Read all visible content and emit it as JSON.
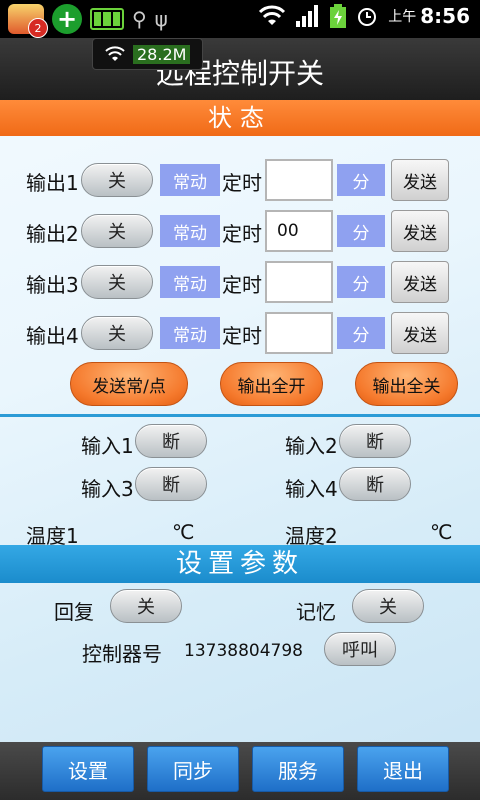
{
  "status_bar": {
    "notification_badge": "2",
    "plus_symbol": "+",
    "am_pm": "上午",
    "time": "8:56",
    "icons": [
      "app-notification-icon",
      "plus-app-icon",
      "battery-widget-icon",
      "android-debug-icon",
      "usb-icon",
      "wifi-icon",
      "signal-icon",
      "battery-charging-icon",
      "alarm-icon"
    ]
  },
  "net_overlay": {
    "speed": "28.2M"
  },
  "title": "远程控制开关",
  "status_section": {
    "header": "状态"
  },
  "outputs": [
    {
      "label": "输出1",
      "toggle": "关",
      "mode": "常动",
      "timer_label": "定时",
      "timer_value": "",
      "unit": "分",
      "send": "发送"
    },
    {
      "label": "输出2",
      "toggle": "关",
      "mode": "常动",
      "timer_label": "定时",
      "timer_value": "00",
      "unit": "分",
      "send": "发送"
    },
    {
      "label": "输出3",
      "toggle": "关",
      "mode": "常动",
      "timer_label": "定时",
      "timer_value": "",
      "unit": "分",
      "send": "发送"
    },
    {
      "label": "输出4",
      "toggle": "关",
      "mode": "常动",
      "timer_label": "定时",
      "timer_value": "",
      "unit": "分",
      "send": "发送"
    }
  ],
  "action_buttons": {
    "send_mode": "发送常/点",
    "all_on": "输出全开",
    "all_off": "输出全关"
  },
  "inputs": [
    {
      "label": "输入1",
      "state": "断"
    },
    {
      "label": "输入2",
      "state": "断"
    },
    {
      "label": "输入3",
      "state": "断"
    },
    {
      "label": "输入4",
      "state": "断"
    }
  ],
  "temperatures": [
    {
      "label": "温度1",
      "unit": "℃"
    },
    {
      "label": "温度2",
      "unit": "℃"
    }
  ],
  "settings_section": {
    "header": "设置参数",
    "reply_label": "回复",
    "reply_toggle": "关",
    "memory_label": "记忆",
    "memory_toggle": "关",
    "controller_label": "控制器号",
    "controller_number": "13738804798",
    "call_button": "呼叫"
  },
  "bottom_nav": {
    "settings": "设置",
    "sync": "同步",
    "service": "服务",
    "exit": "退出"
  },
  "colors": {
    "orange_header": "#f06a17",
    "blue_header": "#1b8ccc",
    "mode_box": "#8fa1f0",
    "nav_button": "#1f6fc8"
  }
}
